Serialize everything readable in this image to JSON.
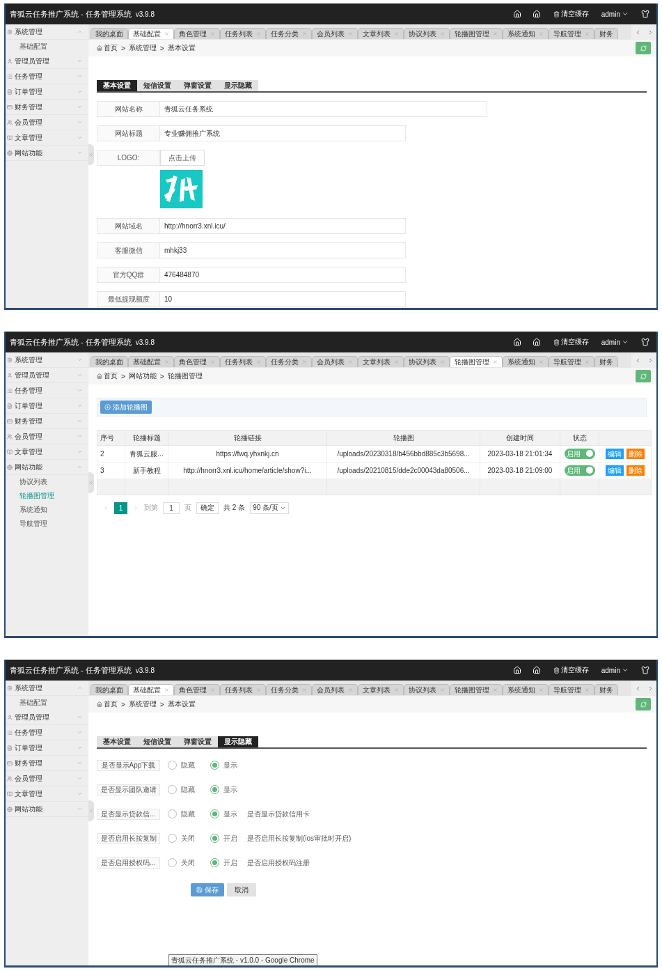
{
  "screens": [
    {
      "header": {
        "title": "青狐云任务推广系统 - 任务管理系统",
        "version": "v3.9.8",
        "cache": "清空缓存",
        "user": "admin"
      },
      "tabs": [
        {
          "label": "我的桌面",
          "selected": false,
          "closable": false
        },
        {
          "label": "基础配置",
          "selected": true,
          "closable": true
        },
        {
          "label": "角色管理",
          "selected": false,
          "closable": true
        },
        {
          "label": "任务列表",
          "selected": false,
          "closable": true
        },
        {
          "label": "任务分类",
          "selected": false,
          "closable": true
        },
        {
          "label": "会员列表",
          "selected": false,
          "closable": true
        },
        {
          "label": "文章列表",
          "selected": false,
          "closable": true
        },
        {
          "label": "协议列表",
          "selected": false,
          "closable": true
        },
        {
          "label": "轮播图管理",
          "selected": false,
          "closable": true
        },
        {
          "label": "系统通知",
          "selected": false,
          "closable": true
        },
        {
          "label": "导航管理",
          "selected": false,
          "closable": true
        },
        {
          "label": "财务",
          "selected": false,
          "closable": false
        }
      ],
      "sidebar": [
        {
          "label": "系统管理",
          "expanded": true,
          "children": [
            {
              "label": "基础配置",
              "selected": false
            }
          ]
        },
        {
          "label": "管理员管理",
          "expanded": false
        },
        {
          "label": "任务管理",
          "expanded": false
        },
        {
          "label": "订单管理",
          "expanded": false
        },
        {
          "label": "财务管理",
          "expanded": false
        },
        {
          "label": "会员管理",
          "expanded": false
        },
        {
          "label": "文章管理",
          "expanded": false
        },
        {
          "label": "网站功能",
          "expanded": false
        }
      ],
      "breadcrumb": [
        {
          "label": "首页"
        },
        {
          "separator": ">",
          "label": "系统管理"
        },
        {
          "separator": ">",
          "label": "基本设置"
        }
      ],
      "content": {
        "kind": "settings_form",
        "subtabs": [
          {
            "label": "基本设置",
            "selected": true
          },
          {
            "label": "短信设置",
            "selected": false
          },
          {
            "label": "弹窗设置",
            "selected": false
          },
          {
            "label": "显示隐藏",
            "selected": false
          }
        ],
        "fields": [
          {
            "kind": "text",
            "label": "网站名称",
            "value": "青狐云任务系统",
            "wide": true
          },
          {
            "kind": "text",
            "label": "网站标题",
            "value": "专业赚佣推广系统",
            "wide": false
          },
          {
            "kind": "upload",
            "label": "LOGO:",
            "button": "点击上传"
          },
          {
            "kind": "text",
            "label": "网站域名",
            "value": "http://hnorr3.xnl.icu/",
            "wide": false
          },
          {
            "kind": "text",
            "label": "客服微信",
            "value": "mhkj33",
            "wide": false
          },
          {
            "kind": "text",
            "label": "官方QQ群",
            "value": "476484870",
            "wide": false
          },
          {
            "kind": "text",
            "label": "最低提现额度",
            "value": "10",
            "wide": false
          }
        ]
      }
    },
    {
      "header": {
        "title": "青狐云任务推广系统 - 任务管理系统",
        "version": "v3.9.8",
        "cache": "清空缓存",
        "user": "admin"
      },
      "tabs": [
        {
          "label": "我的桌面",
          "selected": false,
          "closable": false
        },
        {
          "label": "基础配置",
          "selected": false,
          "closable": true
        },
        {
          "label": "角色管理",
          "selected": false,
          "closable": true
        },
        {
          "label": "任务列表",
          "selected": false,
          "closable": true
        },
        {
          "label": "任务分类",
          "selected": false,
          "closable": true
        },
        {
          "label": "会员列表",
          "selected": false,
          "closable": true
        },
        {
          "label": "文章列表",
          "selected": false,
          "closable": true
        },
        {
          "label": "协议列表",
          "selected": false,
          "closable": true
        },
        {
          "label": "轮播图管理",
          "selected": true,
          "closable": true
        },
        {
          "label": "系统通知",
          "selected": false,
          "closable": true
        },
        {
          "label": "导航管理",
          "selected": false,
          "closable": true
        },
        {
          "label": "财务",
          "selected": false,
          "closable": false
        }
      ],
      "sidebar": [
        {
          "label": "系统管理",
          "expanded": false
        },
        {
          "label": "管理员管理",
          "expanded": false
        },
        {
          "label": "任务管理",
          "expanded": false
        },
        {
          "label": "订单管理",
          "expanded": false
        },
        {
          "label": "财务管理",
          "expanded": false
        },
        {
          "label": "会员管理",
          "expanded": false
        },
        {
          "label": "文章管理",
          "expanded": false
        },
        {
          "label": "网站功能",
          "expanded": true,
          "children": [
            {
              "label": "协议列表",
              "selected": false
            },
            {
              "label": "轮播图管理",
              "selected": true
            },
            {
              "label": "系统通知",
              "selected": false
            },
            {
              "label": "导航管理",
              "selected": false
            }
          ]
        }
      ],
      "breadcrumb": [
        {
          "label": "首页"
        },
        {
          "separator": ">",
          "label": "网站功能"
        },
        {
          "separator": ">",
          "label": "轮播图管理"
        }
      ],
      "content": {
        "kind": "table",
        "add_button": "添加轮播图",
        "columns": [
          "序号",
          "轮播标题",
          "轮播链接",
          "轮播图",
          "创建时间",
          "状态"
        ],
        "rows": [
          {
            "cells": [
              "2",
              "青狐云服...",
              "https://fwq.yhxnkj.cn",
              "/uploads/20230318/b456bbd885c3b5698...",
              "2023-03-18 21:01:34"
            ],
            "status": {
              "label": "启用",
              "on": true
            },
            "actions": [
              "编辑",
              "删除"
            ]
          },
          {
            "cells": [
              "3",
              "新手教程",
              "http://hnorr3.xnl.icu/home/article/show?i...",
              "/uploads/20210815/dde2c00043da80506...",
              "2023-03-18 21:09:00"
            ],
            "status": {
              "label": "启用",
              "on": true
            },
            "actions": [
              "编辑",
              "删除"
            ]
          }
        ],
        "pagination": {
          "pages": [
            {
              "label": "1",
              "selected": true
            }
          ],
          "goto": "到第",
          "page_value": "1",
          "page_unit": "页",
          "confirm": "确定",
          "total": "共 2 条",
          "per_page": "90 条/页"
        }
      }
    },
    {
      "header": {
        "title": "青狐云任务推广系统 - 任务管理系统",
        "version": "v3.9.8",
        "cache": "清空缓存",
        "user": "admin"
      },
      "tabs": [
        {
          "label": "我的桌面",
          "selected": false,
          "closable": false
        },
        {
          "label": "基础配置",
          "selected": true,
          "closable": true
        },
        {
          "label": "角色管理",
          "selected": false,
          "closable": true
        },
        {
          "label": "任务列表",
          "selected": false,
          "closable": true
        },
        {
          "label": "任务分类",
          "selected": false,
          "closable": true
        },
        {
          "label": "会员列表",
          "selected": false,
          "closable": true
        },
        {
          "label": "文章列表",
          "selected": false,
          "closable": true
        },
        {
          "label": "协议列表",
          "selected": false,
          "closable": true
        },
        {
          "label": "轮播图管理",
          "selected": false,
          "closable": true
        },
        {
          "label": "系统通知",
          "selected": false,
          "closable": true
        },
        {
          "label": "导航管理",
          "selected": false,
          "closable": true
        },
        {
          "label": "财务",
          "selected": false,
          "closable": false
        }
      ],
      "sidebar": [
        {
          "label": "系统管理",
          "expanded": true,
          "children": [
            {
              "label": "基础配置",
              "selected": false
            }
          ]
        },
        {
          "label": "管理员管理",
          "expanded": false
        },
        {
          "label": "任务管理",
          "expanded": false
        },
        {
          "label": "订单管理",
          "expanded": false
        },
        {
          "label": "财务管理",
          "expanded": false
        },
        {
          "label": "会员管理",
          "expanded": false
        },
        {
          "label": "文章管理",
          "expanded": false
        },
        {
          "label": "网站功能",
          "expanded": false
        }
      ],
      "breadcrumb": [
        {
          "label": "首页"
        },
        {
          "separator": ">",
          "label": "系统管理"
        },
        {
          "separator": ">",
          "label": "基本设置"
        }
      ],
      "content": {
        "kind": "radio_form",
        "subtabs": [
          {
            "label": "基本设置",
            "selected": false
          },
          {
            "label": "短信设置",
            "selected": false
          },
          {
            "label": "弹窗设置",
            "selected": false
          },
          {
            "label": "显示隐藏",
            "selected": true
          }
        ],
        "rows": [
          {
            "label": "是否显示App下载",
            "options": [
              {
                "label": "隐藏",
                "selected": false
              },
              {
                "label": "显示",
                "selected": true
              }
            ]
          },
          {
            "label": "是否显示团队邀请",
            "options": [
              {
                "label": "隐藏",
                "selected": false
              },
              {
                "label": "显示",
                "selected": true
              }
            ]
          },
          {
            "label": "是否显示贷款信...",
            "options": [
              {
                "label": "隐藏",
                "selected": false
              },
              {
                "label": "显示",
                "selected": true
              }
            ],
            "note": "是否显示贷款信用卡"
          },
          {
            "label": "是否启用长按复制",
            "options": [
              {
                "label": "关闭",
                "selected": false
              },
              {
                "label": "开启",
                "selected": true
              }
            ],
            "note": "是否启用长按复制(ios审批时开启)"
          },
          {
            "label": "是否启用授权码...",
            "options": [
              {
                "label": "关闭",
                "selected": false
              },
              {
                "label": "开启",
                "selected": true
              }
            ],
            "note": "是否启用授权码注册"
          }
        ],
        "save": "保存",
        "cancel": "取消"
      },
      "tooltip": "青狐云任务推广系统 - v1.0.0 - Google Chrome"
    }
  ]
}
